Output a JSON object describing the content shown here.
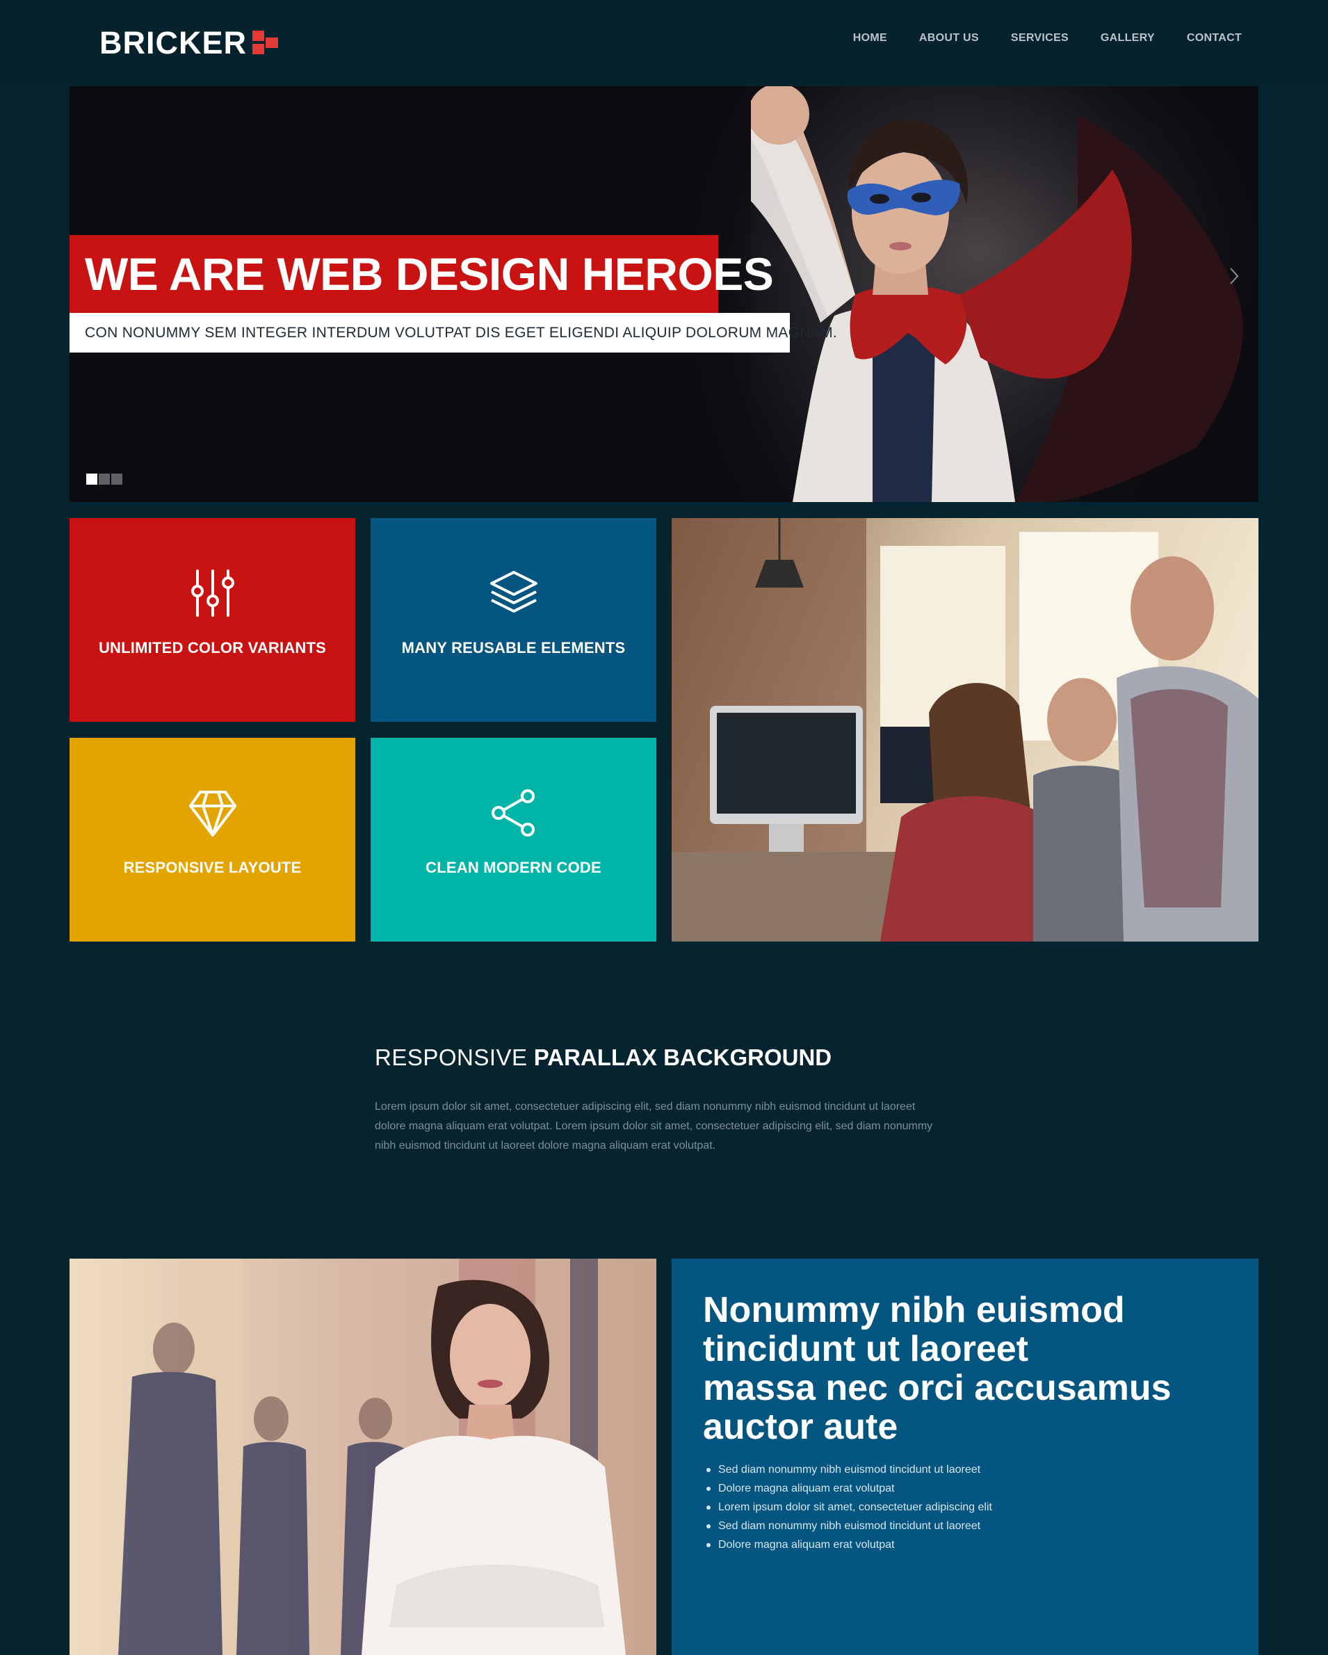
{
  "brand": {
    "name": "BRICKER",
    "accent": "#e53935"
  },
  "nav": {
    "items": [
      "HOME",
      "ABOUT US",
      "SERVICES",
      "GALLERY",
      "CONTACT"
    ]
  },
  "hero": {
    "title": "WE ARE WEB DESIGN HEROES",
    "subtitle": "CON NONUMMY SEM INTEGER INTERDUM VOLUTPAT DIS EGET ELIGENDI ALIQUIP DOLORUM MAGNAM.",
    "slides_count": 3,
    "active_slide": 1
  },
  "features": [
    {
      "label": "UNLIMITED COLOR VARIANTS",
      "icon": "sliders-icon",
      "color": "#c91212"
    },
    {
      "label": "MANY REUSABLE ELEMENTS",
      "icon": "layers-icon",
      "color": "#045580"
    },
    {
      "label": "RESPONSIVE LAYOUTE",
      "icon": "diamond-icon",
      "color": "#e3a400"
    },
    {
      "label": "CLEAN MODERN CODE",
      "icon": "share-icon",
      "color": "#00b4a7"
    }
  ],
  "parallax": {
    "title_light": "RESPONSIVE",
    "title_bold": "PARALLAX BACKGROUND",
    "text": "Lorem ipsum dolor sit amet, consectetuer adipiscing elit, sed diam nonummy nibh euismod tincidunt ut laoreet dolore magna aliquam erat volutpat. Lorem ipsum dolor sit amet, consectetuer adipiscing elit, sed diam nonummy nibh euismod tincidunt ut laoreet dolore magna aliquam erat volutpat."
  },
  "info": {
    "heading_lines": [
      "Nonummy nibh euismod",
      "tincidunt ut laoreet",
      "massa nec orci accusamus",
      "auctor aute"
    ],
    "bullets": [
      "Sed diam nonummy nibh euismod tincidunt ut laoreet",
      "Dolore magna aliquam erat volutpat",
      "Lorem ipsum dolor sit amet, consectetuer adipiscing elit",
      "Sed diam nonummy nibh euismod tincidunt ut laoreet",
      "Dolore magna aliquam erat volutpat"
    ]
  }
}
